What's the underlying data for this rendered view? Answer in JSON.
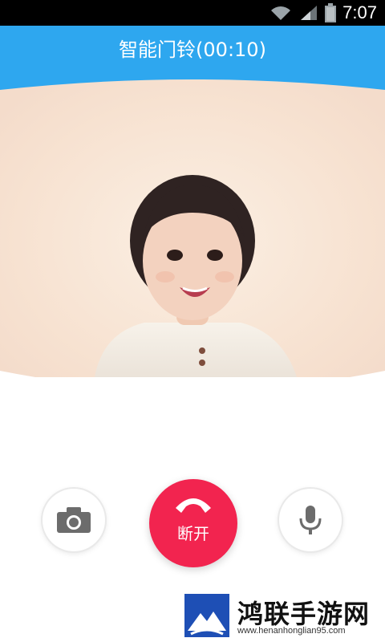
{
  "status_bar": {
    "time": "7:07",
    "icons": [
      "wifi-icon",
      "signal-icon",
      "battery-icon"
    ]
  },
  "header": {
    "title": "智能门铃(00:10)",
    "color": "#2ea7ef"
  },
  "video": {
    "description_icon": "video-feed"
  },
  "controls": {
    "camera_icon": "camera-icon",
    "hangup": {
      "label": "断开",
      "color": "#f2244f",
      "icon": "phone-hangup-icon"
    },
    "mic_icon": "microphone-icon"
  },
  "watermark": {
    "text": "鸿联手游网",
    "url": "www.henanhonglian95.com"
  }
}
